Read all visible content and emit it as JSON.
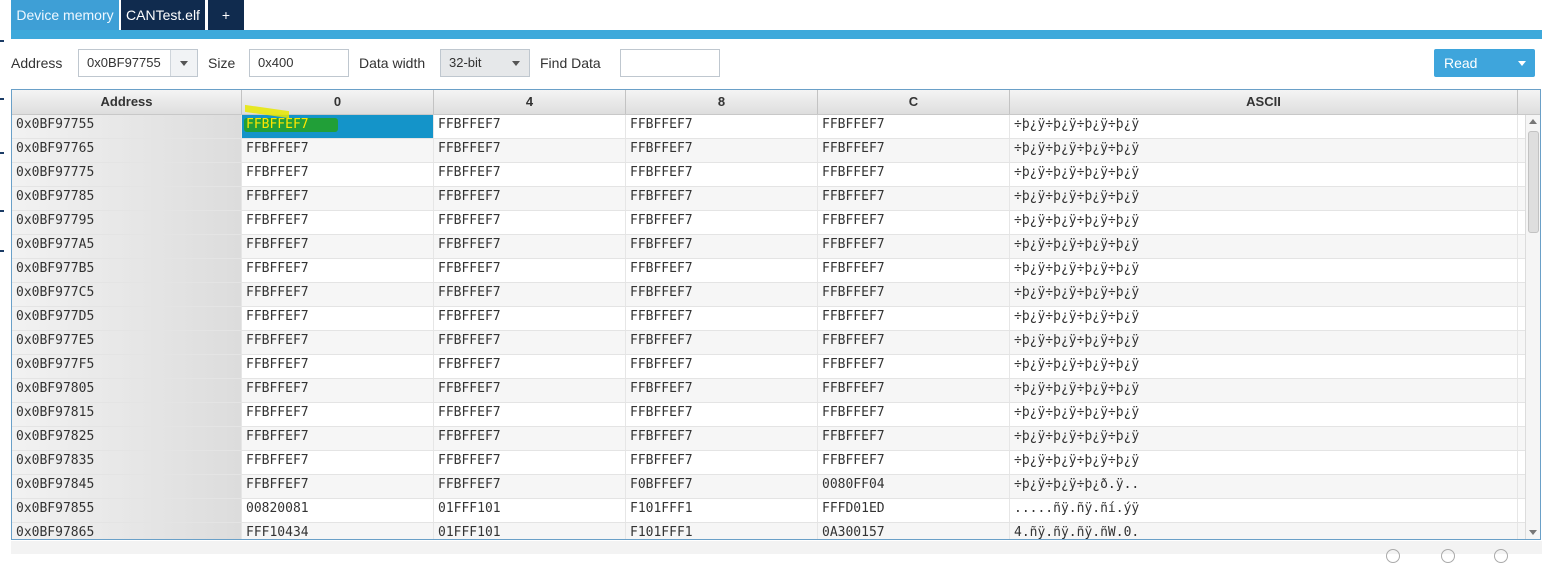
{
  "tabs": [
    {
      "label": "Device memory"
    },
    {
      "label": "CANTest.elf"
    },
    {
      "label": "+"
    }
  ],
  "toolbar": {
    "address_label": "Address",
    "address_value": "0x0BF97755",
    "size_label": "Size",
    "size_value": "0x400",
    "width_label": "Data width",
    "width_value": "32-bit",
    "find_label": "Find Data",
    "find_value": "",
    "read_label": "Read"
  },
  "table": {
    "columns": [
      "Address",
      "0",
      "4",
      "8",
      "C",
      "ASCII"
    ],
    "rows": [
      [
        "0x0BF97755",
        "FFBFFEF7",
        "FFBFFEF7",
        "FFBFFEF7",
        "FFBFFEF7",
        "÷þ¿ÿ÷þ¿ÿ÷þ¿ÿ÷þ¿ÿ"
      ],
      [
        "0x0BF97765",
        "FFBFFEF7",
        "FFBFFEF7",
        "FFBFFEF7",
        "FFBFFEF7",
        "÷þ¿ÿ÷þ¿ÿ÷þ¿ÿ÷þ¿ÿ"
      ],
      [
        "0x0BF97775",
        "FFBFFEF7",
        "FFBFFEF7",
        "FFBFFEF7",
        "FFBFFEF7",
        "÷þ¿ÿ÷þ¿ÿ÷þ¿ÿ÷þ¿ÿ"
      ],
      [
        "0x0BF97785",
        "FFBFFEF7",
        "FFBFFEF7",
        "FFBFFEF7",
        "FFBFFEF7",
        "÷þ¿ÿ÷þ¿ÿ÷þ¿ÿ÷þ¿ÿ"
      ],
      [
        "0x0BF97795",
        "FFBFFEF7",
        "FFBFFEF7",
        "FFBFFEF7",
        "FFBFFEF7",
        "÷þ¿ÿ÷þ¿ÿ÷þ¿ÿ÷þ¿ÿ"
      ],
      [
        "0x0BF977A5",
        "FFBFFEF7",
        "FFBFFEF7",
        "FFBFFEF7",
        "FFBFFEF7",
        "÷þ¿ÿ÷þ¿ÿ÷þ¿ÿ÷þ¿ÿ"
      ],
      [
        "0x0BF977B5",
        "FFBFFEF7",
        "FFBFFEF7",
        "FFBFFEF7",
        "FFBFFEF7",
        "÷þ¿ÿ÷þ¿ÿ÷þ¿ÿ÷þ¿ÿ"
      ],
      [
        "0x0BF977C5",
        "FFBFFEF7",
        "FFBFFEF7",
        "FFBFFEF7",
        "FFBFFEF7",
        "÷þ¿ÿ÷þ¿ÿ÷þ¿ÿ÷þ¿ÿ"
      ],
      [
        "0x0BF977D5",
        "FFBFFEF7",
        "FFBFFEF7",
        "FFBFFEF7",
        "FFBFFEF7",
        "÷þ¿ÿ÷þ¿ÿ÷þ¿ÿ÷þ¿ÿ"
      ],
      [
        "0x0BF977E5",
        "FFBFFEF7",
        "FFBFFEF7",
        "FFBFFEF7",
        "FFBFFEF7",
        "÷þ¿ÿ÷þ¿ÿ÷þ¿ÿ÷þ¿ÿ"
      ],
      [
        "0x0BF977F5",
        "FFBFFEF7",
        "FFBFFEF7",
        "FFBFFEF7",
        "FFBFFEF7",
        "÷þ¿ÿ÷þ¿ÿ÷þ¿ÿ÷þ¿ÿ"
      ],
      [
        "0x0BF97805",
        "FFBFFEF7",
        "FFBFFEF7",
        "FFBFFEF7",
        "FFBFFEF7",
        "÷þ¿ÿ÷þ¿ÿ÷þ¿ÿ÷þ¿ÿ"
      ],
      [
        "0x0BF97815",
        "FFBFFEF7",
        "FFBFFEF7",
        "FFBFFEF7",
        "FFBFFEF7",
        "÷þ¿ÿ÷þ¿ÿ÷þ¿ÿ÷þ¿ÿ"
      ],
      [
        "0x0BF97825",
        "FFBFFEF7",
        "FFBFFEF7",
        "FFBFFEF7",
        "FFBFFEF7",
        "÷þ¿ÿ÷þ¿ÿ÷þ¿ÿ÷þ¿ÿ"
      ],
      [
        "0x0BF97835",
        "FFBFFEF7",
        "FFBFFEF7",
        "FFBFFEF7",
        "FFBFFEF7",
        "÷þ¿ÿ÷þ¿ÿ÷þ¿ÿ÷þ¿ÿ"
      ],
      [
        "0x0BF97845",
        "FFBFFEF7",
        "FFBFFEF7",
        "F0BFFEF7",
        "0080FF04",
        "÷þ¿ÿ÷þ¿ÿ÷þ¿ð.ÿ.."
      ],
      [
        "0x0BF97855",
        "00820081",
        "01FFF101",
        "F101FFF1",
        "FFFD01ED",
        ".....ñÿ.ñÿ.ñí.ýÿ"
      ],
      [
        "0x0BF97865",
        "FFF10434",
        "01FFF101",
        "F101FFF1",
        "0A300157",
        "4.ñÿ.ñÿ.ñÿ.ñW.0."
      ]
    ]
  },
  "colors": {
    "accent": "#3ea9db",
    "tab_dark": "#102b4e",
    "selection": "#1494c9"
  }
}
